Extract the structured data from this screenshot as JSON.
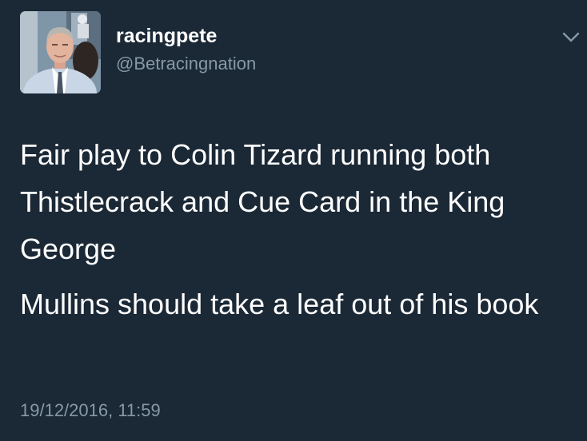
{
  "tweet": {
    "display_name": "racingpete",
    "handle": "@Betracingnation",
    "paragraphs": [
      "Fair play to Colin Tizard running both Thistlecrack and Cue Card in the King George",
      "Mullins should take a leaf out of his book"
    ],
    "timestamp": "19/12/2016, 11:59"
  },
  "icons": {
    "menu": "chevron-down-icon",
    "avatar": "profile-photo"
  },
  "colors": {
    "background": "#1b2836",
    "primary_text": "#ffffff",
    "secondary_text": "#8899a6"
  }
}
